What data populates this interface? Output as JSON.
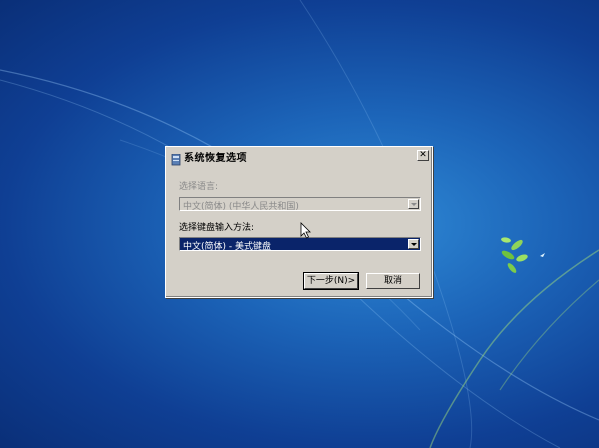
{
  "window": {
    "title": "系统恢复选项",
    "close_symbol": "✕"
  },
  "language": {
    "label": "选择语言:",
    "value": "中文(简体) (中华人民共和国)"
  },
  "keyboard": {
    "label": "选择键盘输入方法:",
    "value": "中文(简体) - 美式键盘"
  },
  "buttons": {
    "next": "下一步(N)>",
    "cancel": "取消"
  },
  "colors": {
    "dialog_bg": "#d4d0c8",
    "selection": "#0a246a",
    "desktop": "#1c64b8"
  }
}
